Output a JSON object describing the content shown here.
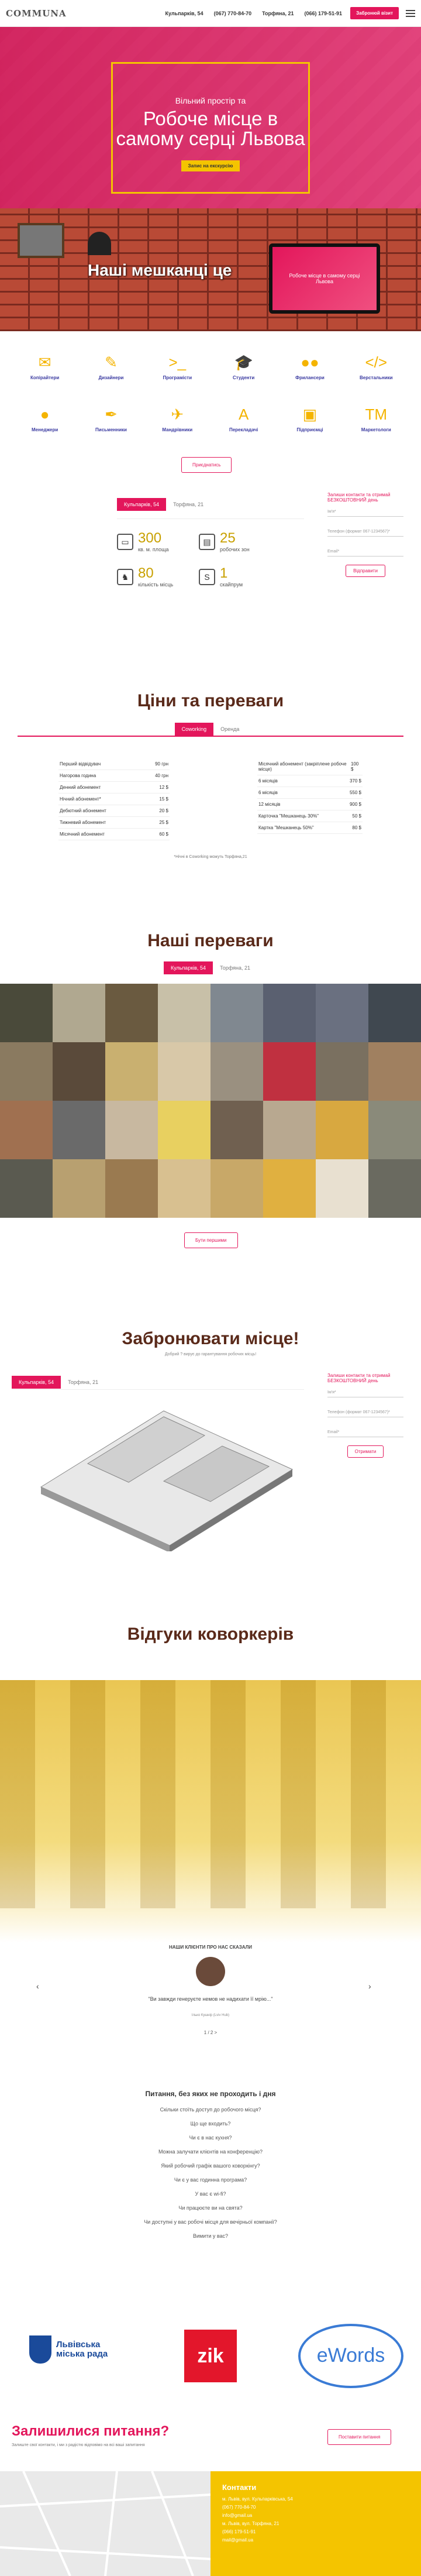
{
  "header": {
    "logo": "CO",
    "logo_rest": "MMUNA",
    "nav": [
      "Кульпарків, 54",
      "(067) 770-84-70",
      "Торфяна, 21",
      "(066) 179-51-91"
    ],
    "cta": "Забронюй візит"
  },
  "hero": {
    "sub": "Вільний простір та",
    "title": "Робоче місце в самому серці Львова",
    "btn": "Запис на екскурсію"
  },
  "residents": {
    "title": "Наші мешканці це",
    "laptop": "Робоче місце в самому серці Львова"
  },
  "icons": {
    "row1": [
      {
        "g": "✉",
        "l": "Копірайтери"
      },
      {
        "g": "✎",
        "l": "Дизайнери"
      },
      {
        "g": ">_",
        "l": "Програмісти"
      },
      {
        "g": "🎓",
        "l": "Студенти"
      },
      {
        "g": "●●",
        "l": "Фрилансери"
      },
      {
        "g": "</>",
        "l": "Верстальники"
      }
    ],
    "row2": [
      {
        "g": "●",
        "l": "Менеджери"
      },
      {
        "g": "✒",
        "l": "Письменники"
      },
      {
        "g": "✈",
        "l": "Мандрівники"
      },
      {
        "g": "A",
        "l": "Перекладачі"
      },
      {
        "g": "▣",
        "l": "Підприємці"
      },
      {
        "g": "TM",
        "l": "Маркетологи"
      }
    ],
    "btn": "Приєднатись"
  },
  "location": {
    "tabs": [
      "Кульпарків, 54",
      "Торфяна, 21"
    ],
    "stats": [
      {
        "n": "300",
        "l": "кв. м. площа"
      },
      {
        "n": "25",
        "l": "робочих зон"
      },
      {
        "n": "80",
        "l": "кількість місць"
      },
      {
        "n": "1",
        "l": "скайпрум"
      }
    ],
    "form_title": "Залиши контакти та отримай БЕЗКОШТОВНИЙ день",
    "fields": [
      "Ім'я*",
      "Телефон (формат 067-1234567)*",
      "Email*"
    ],
    "submit": "Відправити"
  },
  "prices": {
    "title": "Ціни та переваги",
    "tabs": [
      "Coworking",
      "Оренда"
    ],
    "left": [
      [
        "Перший відвідувач",
        "90 грн"
      ],
      [
        "Нагорова година",
        "40 грн"
      ],
      [
        "Денний абонемент",
        "12 $"
      ],
      [
        "Нічний абонемент*",
        "15 $"
      ],
      [
        "Дебютний абонемент",
        "20 $"
      ],
      [
        "Тижневий абонемент",
        "25 $"
      ],
      [
        "Місячний абонемент",
        "60 $"
      ]
    ],
    "right": [
      [
        "Місячний абонемент (закріплене робоче місце)",
        "100 $"
      ],
      [
        "6 місяців",
        "370 $"
      ],
      [
        "6 місяців",
        "550 $"
      ],
      [
        "12 місяців",
        "900 $"
      ],
      [
        "Карточка \"Мешканець 30%\"",
        "50 $"
      ],
      [
        "Картка \"Мешканець 50%\"",
        "80 $"
      ]
    ],
    "note": "*Нічні в Coworking можуть Торфяна,21"
  },
  "advantages": {
    "title": "Наші переваги",
    "tabs": [
      "Кульпарків, 54",
      "Торфяна, 21"
    ],
    "btn": "Бути першими"
  },
  "book": {
    "title": "Забронювати місце!",
    "sub": "Добрий ? вирує до гарантування робочих місць!",
    "tabs": [
      "Кульпарків, 54",
      "Торфяна, 21"
    ],
    "form_title": "Залиши контакти та отримай БЕЗКОШТОВНИЙ день",
    "fields": [
      "Ім'я*",
      "Телефон (формат 067-1234567)*",
      "Email*"
    ],
    "submit": "Отримати"
  },
  "reviews": {
    "title": "Відгуки коворкерів",
    "heading": "НАШИ КЛІЄНТИ ПРО НАС СКАЗАЛИ",
    "quote": "\"Ви завжди генеруєте немов не надихати її мрію...\"",
    "author": "Ілько Кушнір (Lviv Hub)",
    "pager": "1 / 2 >"
  },
  "faq": {
    "title": "Питання, без яких не проходить і дня",
    "items": [
      "Скільки стоїть доступ до робочого місця?",
      "Що ще входить?",
      "Чи є в нас кухня?",
      "Можна залучати клієнтів на конференцію? ",
      "Який робочий графік вашого коворкінгу?",
      "Чи є у вас годинна програма?",
      "У вас є wi-fi?",
      "Чи працюєте ви на свята?",
      "Чи доступні у вас робочі місця для вечірньої компанії?",
      "Вимити у вас?"
    ]
  },
  "partners": {
    "lviv": "Львівська міська рада",
    "zik": "zik",
    "ewords": "eWords"
  },
  "contact": {
    "title": "Залишилися питання?",
    "sub": "Залиште свої контакти, і ми з радістю відповімо на всі ваші запитання",
    "btn": "Поставити питання",
    "col_title": "Контакти",
    "lines": [
      "м. Львів, вул. Кульпарківська, 54",
      "(067) 770-84-70",
      "info@gmail.ua",
      "м. Львів, вул. Торфяна, 21",
      "(066) 179-51-91",
      "mail@gmail.ua"
    ]
  },
  "colors": {
    "pink": "#e3165b",
    "yellow": "#f4c400",
    "brown": "#5a2a1a"
  }
}
